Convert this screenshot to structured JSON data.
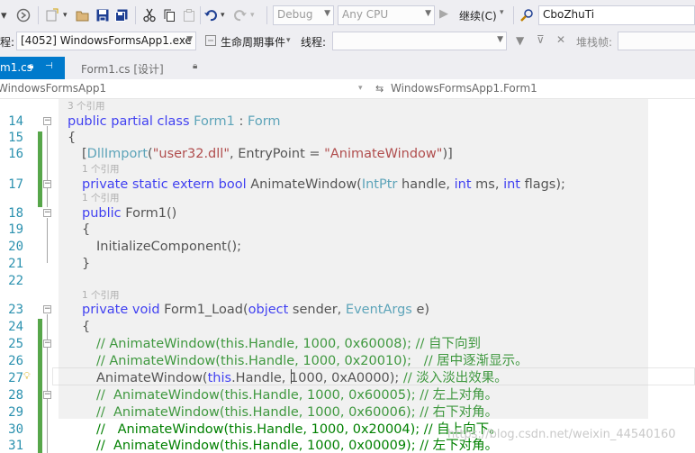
{
  "toolbar": {
    "config_value": "Debug",
    "platform_value": "Any CPU",
    "continue_label": "继续(C)",
    "project_value": "CboZhuTi"
  },
  "debugbar": {
    "process_label": "程:",
    "process_value": "[4052] WindowsFormsApp1.exe",
    "lifecycle_label": "生命周期事件",
    "thread_label": "线程:",
    "stackframe_label": "堆栈帧:"
  },
  "tabs": [
    {
      "label": "m1.cs",
      "active": true
    },
    {
      "label": "Form1.cs [设计]",
      "active": false
    }
  ],
  "nav": {
    "project": "WindowsFormsApp1",
    "type": "WindowsFormsApp1.Form1"
  },
  "editor": {
    "line_numbers": [
      "14",
      "15",
      "16",
      "17",
      "18",
      "19",
      "20",
      "21",
      "22",
      "23",
      "24",
      "25",
      "26",
      "27",
      "28",
      "29",
      "30",
      "31"
    ],
    "lens_ref": "1 个引用",
    "lens_ref_top": "3 个引用",
    "lines": {
      "l14": {
        "k1": "public partial class ",
        "t1": "Form1",
        "p1": " : ",
        "t2": "Form"
      },
      "l15": "{",
      "l16": {
        "p1": "[",
        "t1": "DllImport",
        "p2": "(",
        "s1": "\"user32.dll\"",
        "p3": ", EntryPoint = ",
        "s2": "\"AnimateWindow\"",
        "p4": ")]"
      },
      "l17": {
        "k1": "private static extern bool ",
        "p1": "AnimateWindow(",
        "t1": "IntPtr",
        "p2": " handle, ",
        "k2": "int",
        "p3": " ms, ",
        "k3": "int",
        "p4": " flags);"
      },
      "l18": {
        "k1": "public ",
        "p1": "Form1()"
      },
      "l19": "{",
      "l20": "InitializeComponent();",
      "l21": "}",
      "l23": {
        "k1": "private void ",
        "p1": "Form1_Load(",
        "k2": "object",
        "p2": " sender, ",
        "t1": "EventArgs",
        "p3": " e)"
      },
      "l24": "{",
      "l25": "// AnimateWindow(this.Handle, 1000, 0x60008); // 自下向到",
      "l26": "// AnimateWindow(this.Handle, 1000, 0x20010);   // 居中逐渐显示。",
      "l27": {
        "p1": "AnimateWindow(",
        "k1": "this",
        "p2": ".Handle, 1000, 0xA0000); ",
        "c1": "// 淡入淡出效果。"
      },
      "l28": "//  AnimateWindow(this.Handle, 1000, 0x60005); // 左上对角。",
      "l29": "//  AnimateWindow(this.Handle, 1000, 0x60006); // 右下对角。",
      "l30": "//   AnimateWindow(this.Handle, 1000, 0x20004); // 自上向下。",
      "l31": "//  AnimateWindow(this.Handle, 1000, 0x00009); // 左下对角。"
    }
  },
  "watermark": "https://blog.csdn.net/weixin_44540160",
  "colors": {
    "accent": "#007acc",
    "keyword": "#0000ff",
    "type": "#2b91af",
    "string": "#a31515",
    "comment": "#008000",
    "changed_margin": "#57a64a"
  }
}
